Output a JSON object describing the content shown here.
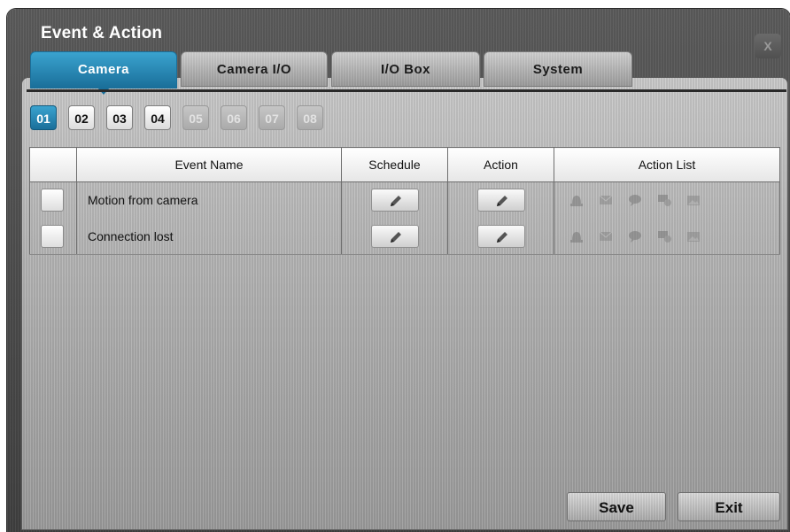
{
  "window": {
    "title": "Event & Action",
    "close_label": "X"
  },
  "tabs": [
    {
      "label": "Camera",
      "active": true
    },
    {
      "label": "Camera I/O",
      "active": false
    },
    {
      "label": "I/O Box",
      "active": false
    },
    {
      "label": "System",
      "active": false
    }
  ],
  "cameras": [
    {
      "label": "01",
      "state": "active"
    },
    {
      "label": "02",
      "state": "enabled"
    },
    {
      "label": "03",
      "state": "enabled"
    },
    {
      "label": "04",
      "state": "enabled"
    },
    {
      "label": "05",
      "state": "disabled"
    },
    {
      "label": "06",
      "state": "disabled"
    },
    {
      "label": "07",
      "state": "disabled"
    },
    {
      "label": "08",
      "state": "disabled"
    }
  ],
  "table": {
    "headers": {
      "event_name": "Event Name",
      "schedule": "Schedule",
      "action": "Action",
      "action_list": "Action List"
    },
    "rows": [
      {
        "event_name": "Motion from camera",
        "checked": false
      },
      {
        "event_name": "Connection lost",
        "checked": false
      }
    ],
    "action_icons": [
      "alarm-icon",
      "email-icon",
      "message-icon",
      "recording-icon",
      "snapshot-icon"
    ]
  },
  "buttons": {
    "save": "Save",
    "exit": "Exit"
  },
  "colors": {
    "accent": "#2a8fbf",
    "panel": "#b8b8b8",
    "frame": "#4a4a4a"
  }
}
